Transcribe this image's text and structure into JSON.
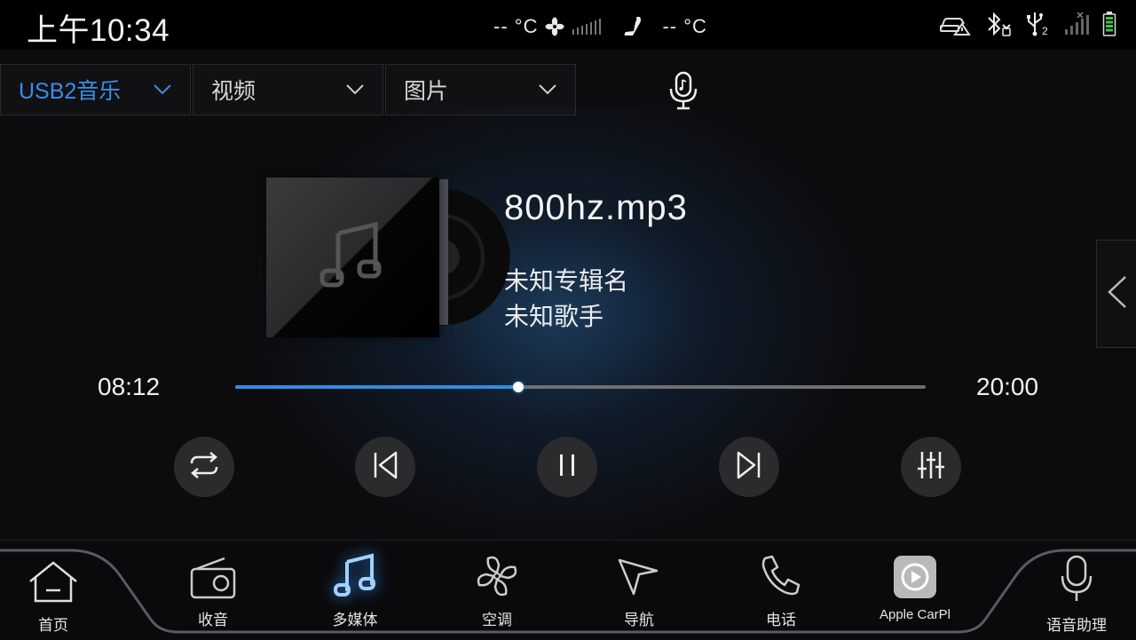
{
  "status_bar": {
    "time": "上午10:34",
    "temp_left": "-- °C",
    "temp_right": "-- °C",
    "icons": [
      "fan-icon",
      "fan-level-icon",
      "seat-heat-icon",
      "car-alert-icon",
      "bluetooth-icon",
      "usb-icon",
      "signal-icon",
      "battery-icon"
    ],
    "usb_index": "2"
  },
  "source_tabs": [
    {
      "label": "USB2音乐",
      "active": true
    },
    {
      "label": "视频",
      "active": false
    },
    {
      "label": "图片",
      "active": false
    }
  ],
  "player": {
    "title": "800hz.mp3",
    "album": "未知专辑名",
    "artist": "未知歌手",
    "current_time": "08:12",
    "total_time": "20:00",
    "progress": 0.41
  },
  "controls": [
    "repeat-icon",
    "previous-icon",
    "pause-icon",
    "next-icon",
    "equalizer-icon"
  ],
  "dock": [
    {
      "label": "首页",
      "icon": "home-icon"
    },
    {
      "label": "收音",
      "icon": "radio-icon"
    },
    {
      "label": "多媒体",
      "icon": "music-icon",
      "active": true
    },
    {
      "label": "空调",
      "icon": "fan-icon"
    },
    {
      "label": "导航",
      "icon": "navigation-icon"
    },
    {
      "label": "电话",
      "icon": "phone-icon"
    },
    {
      "label": "Apple CarPl",
      "icon": "carplay-icon"
    },
    {
      "label": "语音助理",
      "icon": "microphone-icon"
    }
  ],
  "colors": {
    "accent": "#2f8de4",
    "background": "#0c0c0e"
  }
}
